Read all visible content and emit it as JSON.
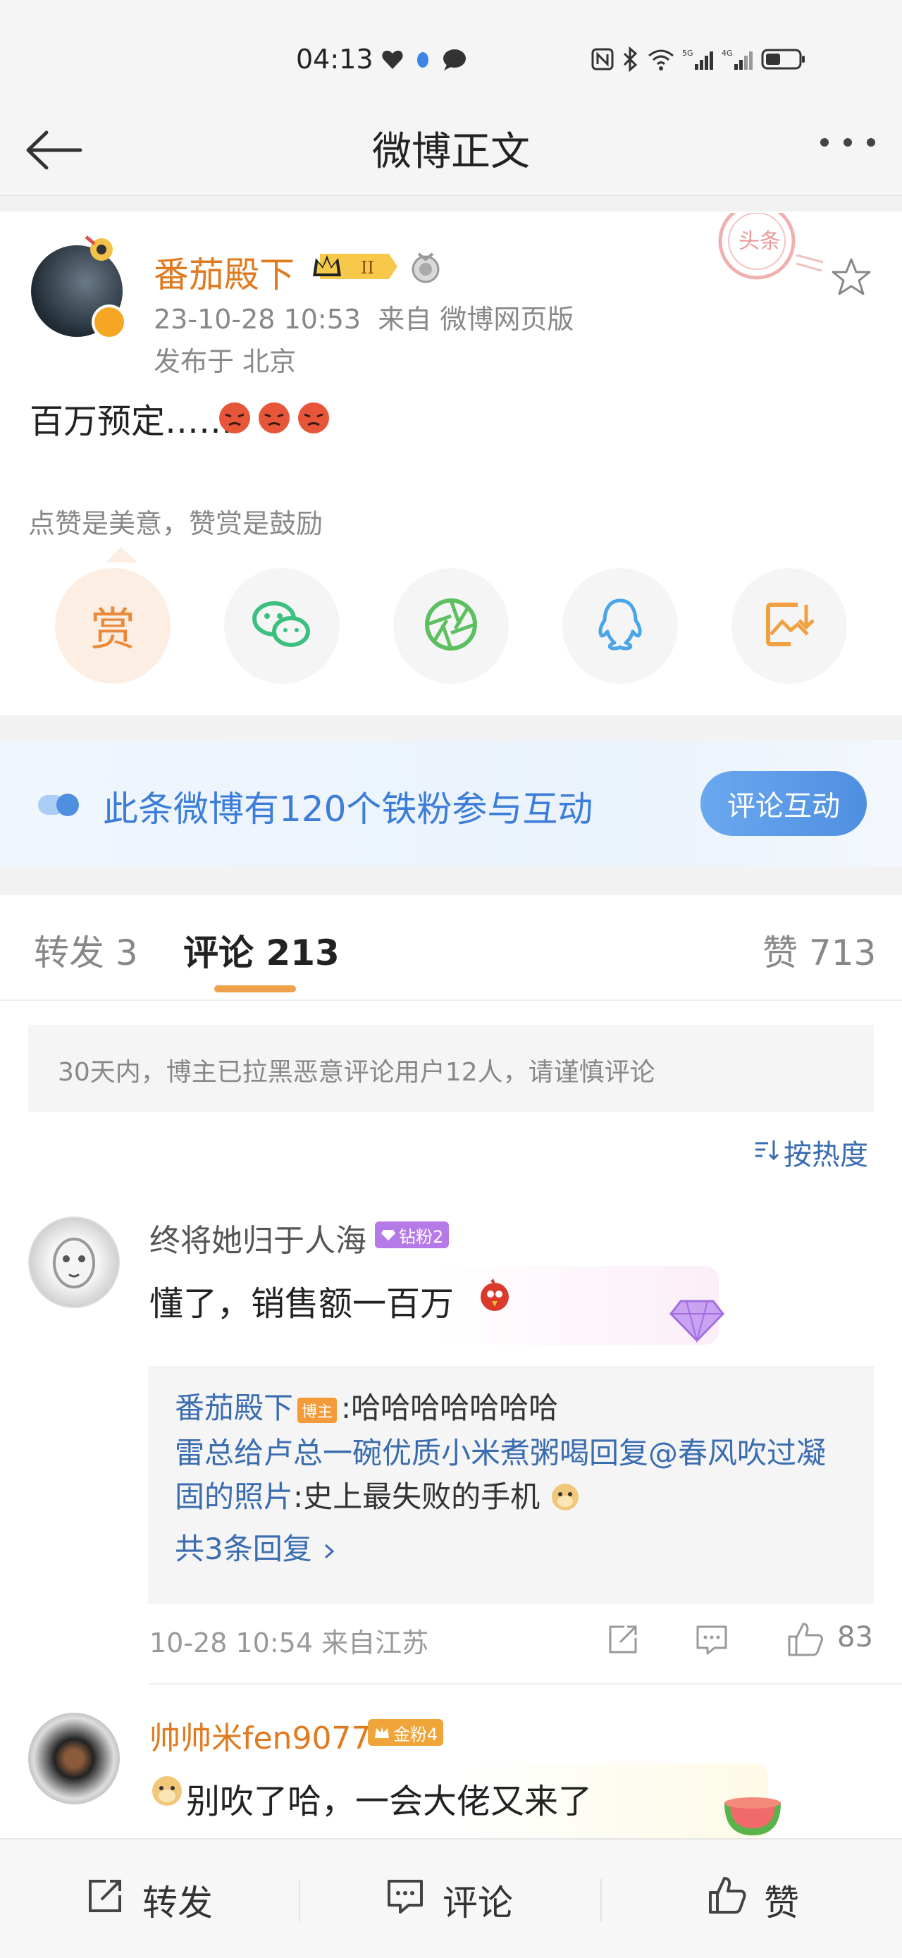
{
  "status_bar": {
    "time": "04:13"
  },
  "nav": {
    "title": "微博正文"
  },
  "post": {
    "author": "番茄殿下",
    "level_badge": "II",
    "time": "23-10-28 10:53",
    "source": "来自 微博网页版",
    "location": "发布于 北京",
    "text": "百万预定……",
    "stamp_text": "头条",
    "reward_tip": "点赞是美意，赞赏是鼓励",
    "reward_label": "赏"
  },
  "banner": {
    "text": "此条微博有120个铁粉参与互动",
    "button": "评论互动"
  },
  "tabs": {
    "repost": "转发 3",
    "comment": "评论 213",
    "like": "赞 713"
  },
  "notice": "30天内，博主已拉黑恶意评论用户12人，请谨慎评论",
  "sort_label": "按热度",
  "comments": [
    {
      "user": "终将她归于人海",
      "badge": "钻粉2",
      "text": "懂了，销售额一百万",
      "replies": {
        "r1_name": "番茄殿下",
        "r1_tag": "博主",
        "r1_text": ":哈哈哈哈哈哈哈",
        "r2_line1": "雷总给卢总一碗优质小米煮粥喝回复@春风吹过凝",
        "r2_line2_link": "固的照片",
        "r2_line2_text": ":史上最失败的手机",
        "more": "共3条回复"
      },
      "meta": "10-28 10:54  来自江苏",
      "likes": "83"
    },
    {
      "user": "帅帅米fen9077",
      "badge": "金粉4",
      "text": "别吹了哈，一会大佬又来了"
    }
  ],
  "bottom_bar": {
    "repost": "转发",
    "comment": "评论",
    "like": "赞"
  },
  "colors": {
    "accent_orange": "#e07a1f",
    "link_blue": "#3a6cb0",
    "banner_blue": "#3b7dd8",
    "tab_underline": "#f0a04b"
  }
}
